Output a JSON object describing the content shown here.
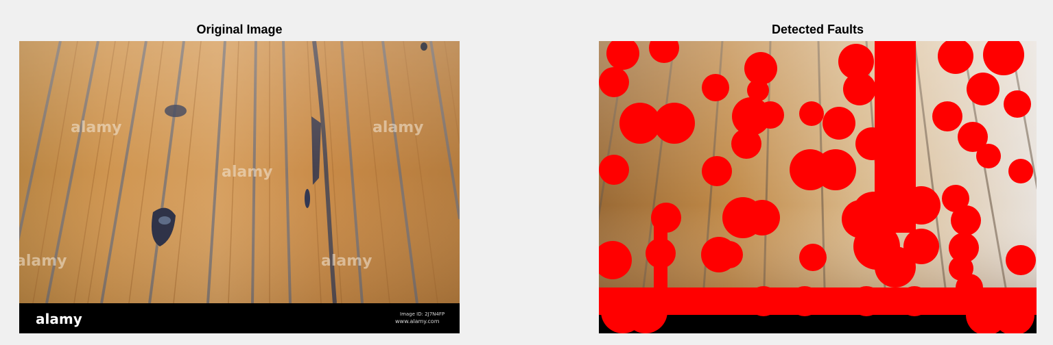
{
  "figure": {
    "left_panel": {
      "title": "Original Image"
    },
    "right_panel": {
      "title": "Detected Faults",
      "overlay_color": "#ff0000"
    }
  },
  "photo": {
    "watermark_text": "alamy",
    "footer_logo": "alamy",
    "footer_id": "Image ID: 2J7N4FP",
    "footer_url": "www.alamy.com"
  },
  "colors": {
    "background": "#f0f0f0",
    "wood_light": "#c68a45",
    "wood_dark": "#8a5a2a",
    "fault_overlay": "#ff0000",
    "footer_bar": "#000000"
  }
}
